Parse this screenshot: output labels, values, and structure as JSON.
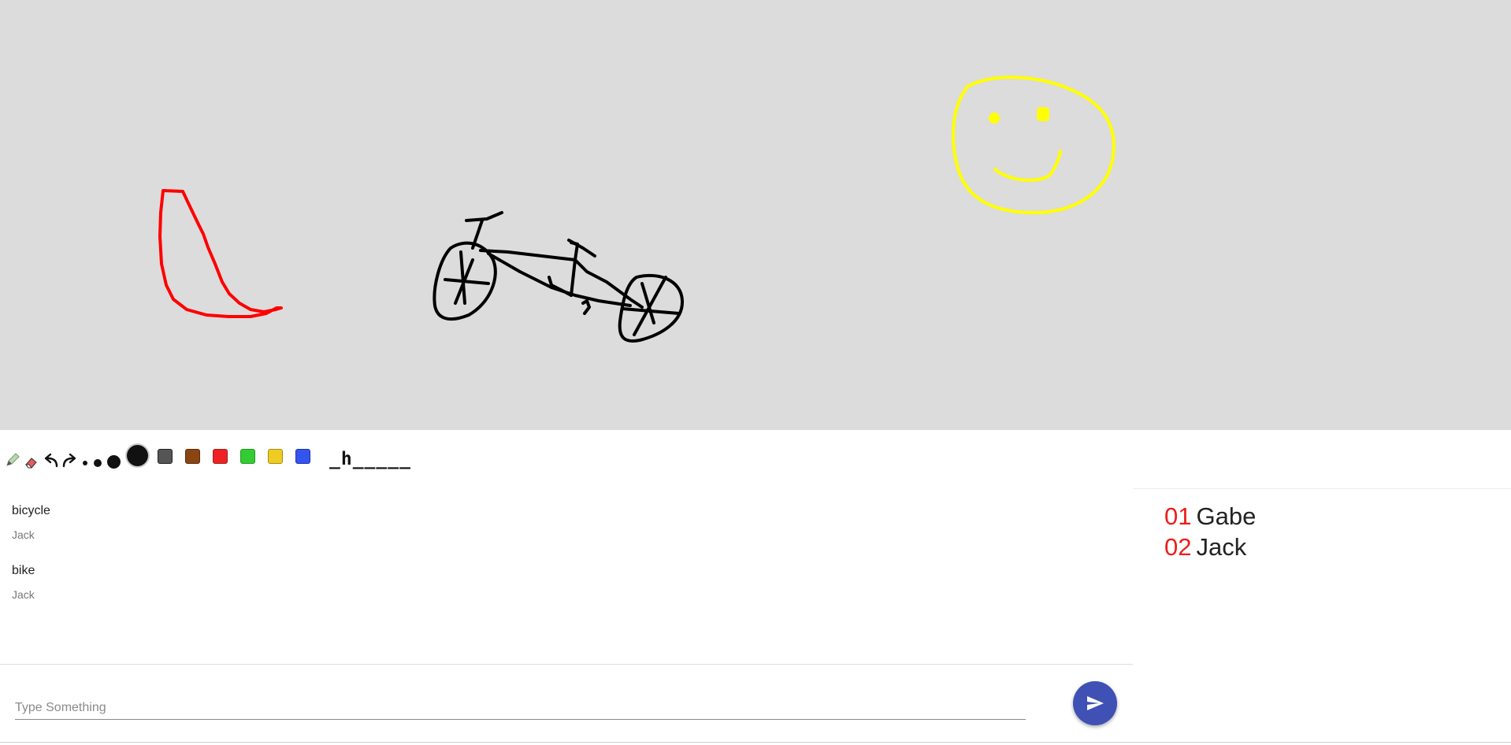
{
  "canvas": {
    "background": "#dcdcdc",
    "drawings": [
      {
        "name": "red-shape",
        "color": "#ff0000"
      },
      {
        "name": "bicycle",
        "color": "#000000"
      },
      {
        "name": "smiley-face",
        "color": "#ffff00"
      }
    ]
  },
  "toolbar": {
    "tools": [
      {
        "name": "pencil-icon",
        "glyph": "pencil"
      },
      {
        "name": "eraser-icon",
        "glyph": "eraser"
      },
      {
        "name": "undo-icon",
        "glyph": "undo"
      },
      {
        "name": "redo-icon",
        "glyph": "redo"
      }
    ],
    "brush_sizes": [
      "extra-small",
      "small",
      "medium",
      "large"
    ],
    "colors": [
      "#000000",
      "#555555",
      "#8b4513",
      "#ee2222",
      "#33cc33",
      "#eecc22",
      "#3355ee"
    ],
    "word_hint": "_h_____"
  },
  "chat": {
    "messages": [
      {
        "text": "bicycle",
        "author": "Jack"
      },
      {
        "text": "bike",
        "author": "Jack"
      }
    ],
    "input_placeholder": "Type Something",
    "send_icon": "send-icon",
    "send_color": "#3f51b5"
  },
  "scoreboard": {
    "rank_color": "#ee1c1c",
    "players": [
      {
        "rank": "01",
        "name": "Gabe"
      },
      {
        "rank": "02",
        "name": "Jack"
      }
    ]
  }
}
